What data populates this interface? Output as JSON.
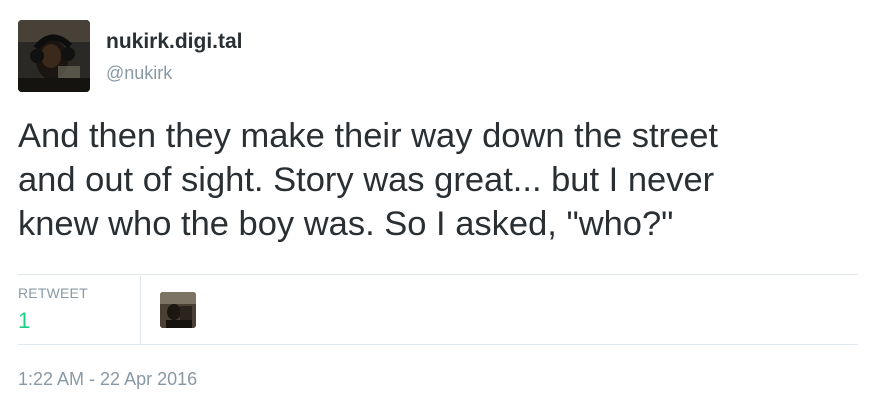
{
  "author": {
    "display_name": "nukirk.digi.tal",
    "handle": "@nukirk"
  },
  "tweet": {
    "lines": [
      "And then they make their way down the street",
      "and out of sight. Story was great... but I never",
      "knew who the boy was. So I asked, \"who?\""
    ]
  },
  "stats": {
    "retweet_label": "RETWEET",
    "retweet_count": "1",
    "retweet_count_color": "#19cf86"
  },
  "timestamp": "1:22 AM - 22 Apr 2016",
  "icons": {
    "author_avatar": "author-avatar-photo",
    "retweeter_avatar": "retweeter-avatar-photo"
  }
}
